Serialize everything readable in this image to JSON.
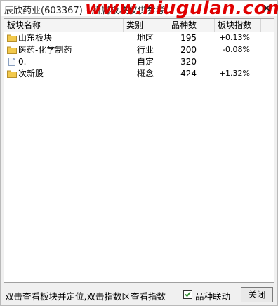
{
  "window": {
    "title": "辰欣药业(603367) - 所属板块仅供参考",
    "watermark": "www.niugulan.com"
  },
  "table": {
    "columns": [
      "板块名称",
      "类别",
      "品种数",
      "板块指数"
    ],
    "rows": [
      {
        "icon": "folder-icon",
        "name": "山东板块",
        "category": "地区",
        "count": "195",
        "change": "+0.13%"
      },
      {
        "icon": "folder-icon",
        "name": "医药-化学制药",
        "category": "行业",
        "count": "200",
        "change": "-0.08%"
      },
      {
        "icon": "document-icon",
        "name": "0.",
        "category": "自定",
        "count": "320",
        "change": ""
      },
      {
        "icon": "folder-icon",
        "name": "次新股",
        "category": "概念",
        "count": "424",
        "change": "+1.32%"
      }
    ]
  },
  "status": {
    "hint": "双击查看板块并定位,双击指数区查看指数",
    "checkbox_label": "品种联动",
    "checkbox_checked": true,
    "close_label": "关闭"
  },
  "colors": {
    "watermark": "#e00000",
    "folder": "#f2c94c",
    "checkmark": "#2e8b2e"
  }
}
